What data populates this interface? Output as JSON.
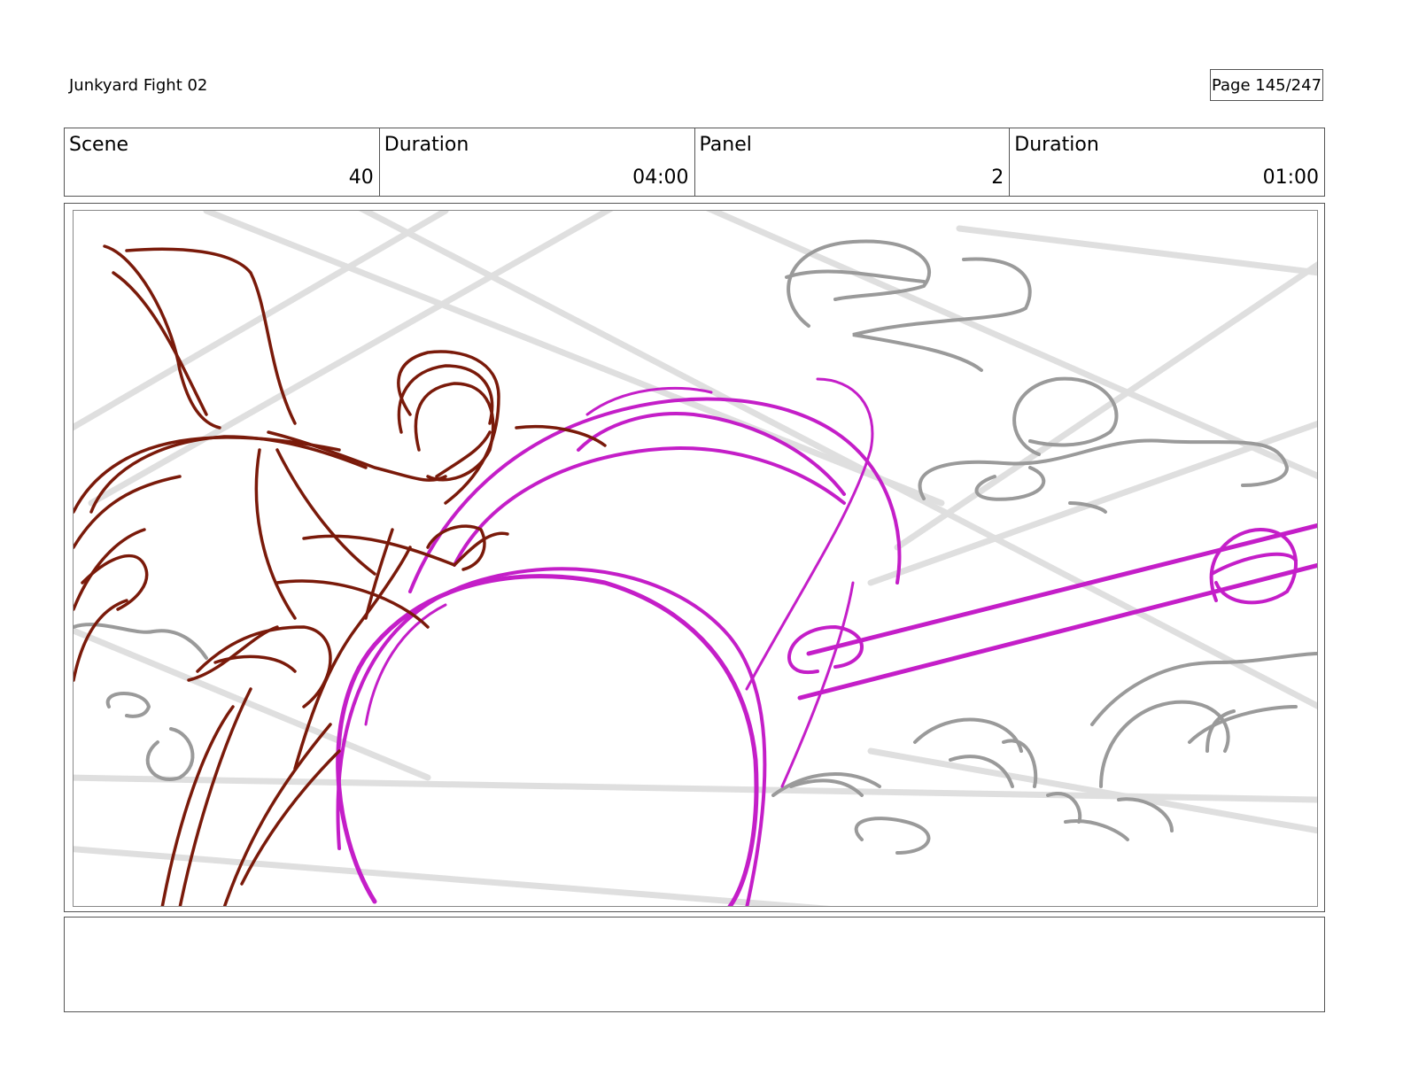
{
  "document": {
    "title": "Junkyard Fight 02",
    "page": "Page 145/247"
  },
  "header": {
    "scene_label": "Scene",
    "scene_value": "40",
    "scene_duration_label": "Duration",
    "scene_duration_value": "04:00",
    "panel_label": "Panel",
    "panel_value": "2",
    "panel_duration_label": "Duration",
    "panel_duration_value": "01:00"
  },
  "sketch": {
    "colors": {
      "character": "#7a1a0a",
      "energy": "#c41ec8",
      "clouds": "#9a9a9a",
      "speed_lines": "#dcdcdc"
    }
  },
  "notes": ""
}
